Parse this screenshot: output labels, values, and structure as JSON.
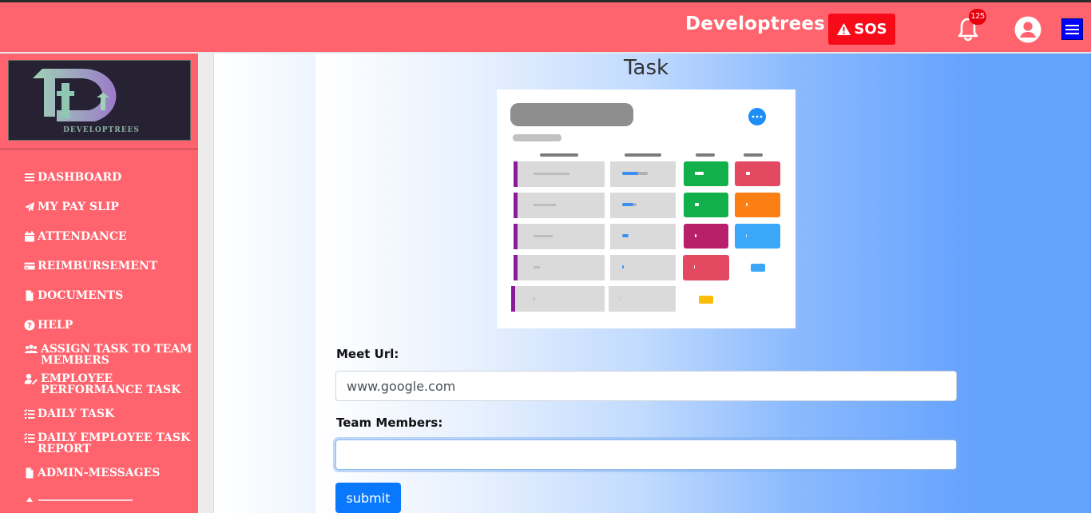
{
  "header": {
    "brand": "Developtrees",
    "sos_label": "SOS",
    "notification_count": "125"
  },
  "sidebar": {
    "logo_text": "DEVELOPTREES",
    "items": [
      {
        "label": "DASHBOARD",
        "icon": "bars-icon"
      },
      {
        "label": "MY PAY SLIP",
        "icon": "paper-plane-icon"
      },
      {
        "label": "ATTENDANCE",
        "icon": "calendar-icon"
      },
      {
        "label": "REIMBURSEMENT",
        "icon": "credit-card-icon"
      },
      {
        "label": "DOCUMENTS",
        "icon": "file-icon"
      },
      {
        "label": "HELP",
        "icon": "question-circle-icon"
      },
      {
        "label": "ASSIGN TASK TO TEAM MEMBERS",
        "icon": "users-icon"
      },
      {
        "label": "EMPLOYEE PERFORMANCE TASK",
        "icon": "user-edit-icon"
      },
      {
        "label": "DAILY TASK",
        "icon": "list-check-icon"
      },
      {
        "label": "DAILY EMPLOYEE TASK REPORT",
        "icon": "list-check-icon"
      },
      {
        "label": "ADMIN-MESSAGES",
        "icon": "file-icon"
      }
    ]
  },
  "main": {
    "title": "Task",
    "meet_url_label": "Meet Url:",
    "meet_url_value": "www.google.com",
    "team_members_label": "Team Members:",
    "team_members_value": "",
    "submit_label": "submit"
  },
  "colors": {
    "topbar": "#ff646e",
    "sos": "#f80b19",
    "accent": "#0a78fc"
  }
}
